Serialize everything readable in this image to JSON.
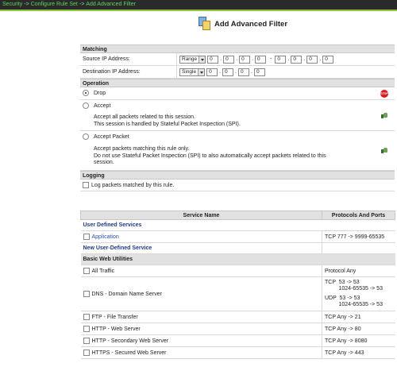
{
  "breadcrumb": [
    "Security",
    "Configure Rule Set",
    "Add Advanced Filter"
  ],
  "breadcrumb_sep": "->",
  "page_title": "Add Advanced Filter",
  "matching": {
    "header": "Matching",
    "source_label": "Source IP Address:",
    "source_mode": "Range",
    "source_from": [
      "0",
      "0",
      "0",
      "0"
    ],
    "source_to": [
      "0",
      "0",
      "0",
      "0"
    ],
    "range_sep": "-",
    "dest_label": "Destination IP Address:",
    "dest_mode": "Single",
    "dest_ip": [
      "0",
      "0",
      "0",
      "0"
    ]
  },
  "operation": {
    "header": "Operation",
    "drop_label": "Drop",
    "drop_badge": "STOP",
    "accept_label": "Accept",
    "accept_desc_1": "Accept all packets related to this session.",
    "accept_desc_2": "This session is handled by Stateful Packet Inspection (SPI).",
    "accept_packet_label": "Accept Packet",
    "accept_packet_desc_1": "Accept packets matching this rule only.",
    "accept_packet_desc_2": "Do not use Stateful Packet Inspection (SPI) to also automatically accept packets related to this",
    "accept_packet_desc_3": "session."
  },
  "logging": {
    "header": "Logging",
    "log_label": "Log packets matched by this rule."
  },
  "services": {
    "col_service": "Service Name",
    "col_protocols": "Protocols And Ports",
    "user_defined_header": "User Defined Services",
    "application_name": "Application",
    "application_proto": "TCP  777 -> 9999-65535",
    "new_service": "New User-Defined Service",
    "basic_header": "Basic Web Utilities",
    "all_traffic": "All Traffic",
    "all_traffic_proto": "Protocol Any",
    "dns_name": "DNS - Domain Name Server",
    "dns_tcp": "TCP  53 -> 53\n         1024-65535 -> 53",
    "dns_udp": "UDP  53 -> 53\n         1024-65535 -> 53",
    "ftp_name": "FTP - File Transfer",
    "ftp_proto": "TCP  Any -> 21",
    "http_name": "HTTP - Web Server",
    "http_proto": "TCP  Any -> 80",
    "http2_name": "HTTP - Secondary Web Server",
    "http2_proto": "TCP  Any -> 8080",
    "https_name": "HTTPS - Secured Web Server",
    "https_proto": "TCP  Any -> 443"
  }
}
